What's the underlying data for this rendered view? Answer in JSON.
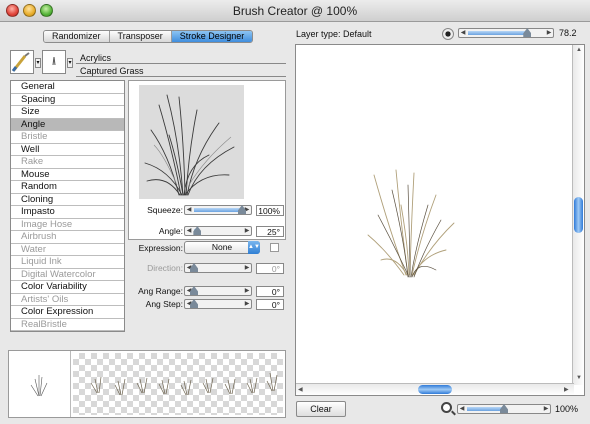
{
  "window": {
    "title": "Brush Creator @ 100%"
  },
  "tabs": [
    {
      "label": "Randomizer",
      "active": false
    },
    {
      "label": "Transposer",
      "active": false
    },
    {
      "label": "Stroke Designer",
      "active": true
    }
  ],
  "brush": {
    "category": "Acrylics",
    "variant": "Captured Grass"
  },
  "sections": [
    {
      "label": "General",
      "state": "normal"
    },
    {
      "label": "Spacing",
      "state": "normal"
    },
    {
      "label": "Size",
      "state": "normal"
    },
    {
      "label": "Angle",
      "state": "selected"
    },
    {
      "label": "Bristle",
      "state": "disabled"
    },
    {
      "label": "Well",
      "state": "normal"
    },
    {
      "label": "Rake",
      "state": "disabled"
    },
    {
      "label": "Mouse",
      "state": "normal"
    },
    {
      "label": "Random",
      "state": "normal"
    },
    {
      "label": "Cloning",
      "state": "normal"
    },
    {
      "label": "Impasto",
      "state": "normal"
    },
    {
      "label": "Image Hose",
      "state": "disabled"
    },
    {
      "label": "Airbrush",
      "state": "disabled"
    },
    {
      "label": "Water",
      "state": "disabled"
    },
    {
      "label": "Liquid Ink",
      "state": "disabled"
    },
    {
      "label": "Digital Watercolor",
      "state": "disabled"
    },
    {
      "label": "Color Variability",
      "state": "normal"
    },
    {
      "label": "Artists' Oils",
      "state": "disabled"
    },
    {
      "label": "Color Expression",
      "state": "normal"
    },
    {
      "label": "RealBristle",
      "state": "disabled"
    }
  ],
  "controls": {
    "squeeze": {
      "label": "Squeeze:",
      "value": "100%",
      "level": 1.0
    },
    "angle": {
      "label": "Angle:",
      "value": "25°",
      "level": 0.07
    },
    "expression": {
      "label": "Expression:",
      "value": "None"
    },
    "direction": {
      "label": "Direction:",
      "value": "0°",
      "level": 0.0
    },
    "ang_range": {
      "label": "Ang Range:",
      "value": "0°",
      "level": 0.0
    },
    "ang_step": {
      "label": "Ang Step:",
      "value": "0°",
      "level": 0.0
    }
  },
  "canvas": {
    "layer_type": "Layer type: Default",
    "opacity_value": "78.2",
    "opacity_level": 0.78,
    "clear_label": "Clear",
    "zoom_value": "100%",
    "zoom_level": 0.5
  },
  "colors": {
    "accent": "#3f8ede",
    "grass_light": "#b0a07a",
    "grass_dark": "#3a3a3a"
  }
}
